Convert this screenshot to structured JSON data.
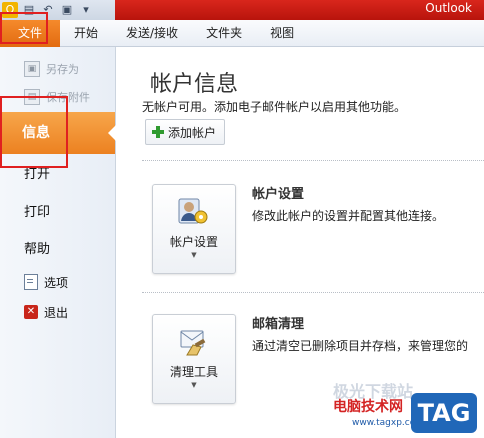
{
  "window": {
    "app_title": "Outlook"
  },
  "ribbon": {
    "file_tab": "文件",
    "tabs": [
      "开始",
      "发送/接收",
      "文件夹",
      "视图"
    ]
  },
  "nav": {
    "save_as": "另存为",
    "save_attachments": "保存附件",
    "info": "信息",
    "open": "打开",
    "print": "打印",
    "help": "帮助",
    "options": "选项",
    "exit": "退出"
  },
  "main": {
    "title": "帐户信息",
    "description": "无帐户可用。添加电子邮件帐户以启用其他功能。",
    "add_account": "添加帐户",
    "account_settings": {
      "button_label": "帐户设置",
      "title": "帐户设置",
      "description": "修改此帐户的设置并配置其他连接。"
    },
    "mailbox_cleanup": {
      "button_label": "清理工具",
      "title": "邮箱清理",
      "description": "通过清空已删除项目并存档，来管理您的"
    }
  },
  "watermark": {
    "text": "电脑技术网",
    "url": "www.tagxp.com",
    "tag": "TAG",
    "faint": "极光下载站"
  },
  "colors": {
    "file_tab": "#e26b10",
    "active_nav": "#ec8121",
    "title_bar_red": "#c8180e",
    "highlight": "#e02020"
  }
}
